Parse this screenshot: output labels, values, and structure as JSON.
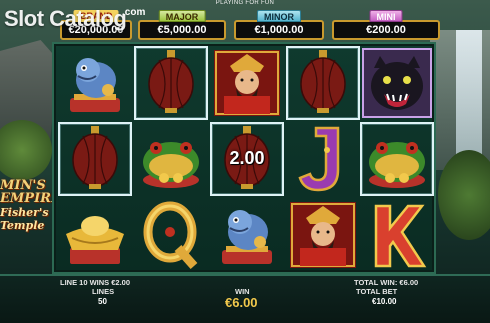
{
  "watermark": {
    "text": "Slot Catalog",
    "suffix": ".com"
  },
  "top_banner": "PLAYING FOR FUN",
  "jackpots": {
    "grand": {
      "label": "GRAND",
      "value": "€20,000.00"
    },
    "major": {
      "label": "MAJOR",
      "value": "€5,000.00"
    },
    "minor": {
      "label": "MINOR",
      "value": "€1,000.00"
    },
    "mini": {
      "label": "MINI",
      "value": "€200.00"
    }
  },
  "logo": {
    "line1": "MIN'S",
    "line2": "EMPIRE",
    "line3": "Fisher's",
    "line4": "Temple"
  },
  "reels": {
    "rows": [
      [
        "foo-dog",
        "lantern",
        "emperor",
        "lantern",
        "panther"
      ],
      [
        "lantern",
        "golden-toad",
        "lantern",
        "letter-j",
        "golden-toad"
      ],
      [
        "gold-ingot",
        "letter-q",
        "foo-dog",
        "emperor",
        "letter-k"
      ]
    ],
    "highlighted_cells": [
      [
        0,
        1
      ],
      [
        0,
        3
      ],
      [
        1,
        0
      ],
      [
        1,
        2
      ],
      [
        1,
        4
      ]
    ],
    "multiplier_cell_value": "2.00"
  },
  "bottom": {
    "line_win": "LINE 10 WINS €2.00",
    "lines_label": "LINES",
    "lines_value": "50",
    "win_label": "WIN",
    "win_value": "€6.00",
    "total_win": "TOTAL WIN: €6.00",
    "total_bet_label": "TOTAL BET",
    "total_bet_value": "€10.00"
  },
  "colors": {
    "frame": "#2c6a53",
    "gold": "#f2c94c",
    "highlight": "#dff3f6"
  }
}
